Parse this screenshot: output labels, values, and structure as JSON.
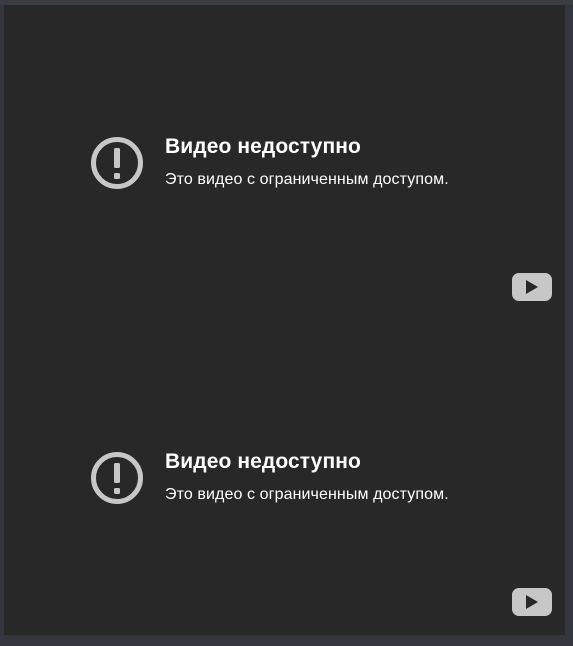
{
  "videos": [
    {
      "title": "Видео недоступно",
      "message": "Это видео с ограниченным доступом.",
      "error_icon": "alert-circle-icon",
      "player_logo": "youtube-icon"
    },
    {
      "title": "Видео недоступно",
      "message": "Это видео с ограниченным доступом.",
      "error_icon": "alert-circle-icon",
      "player_logo": "youtube-icon"
    }
  ],
  "colors": {
    "page_background": "#33373d",
    "player_background": "#282828",
    "icon_gray": "#c7c7c7",
    "text": "#ffffff"
  }
}
